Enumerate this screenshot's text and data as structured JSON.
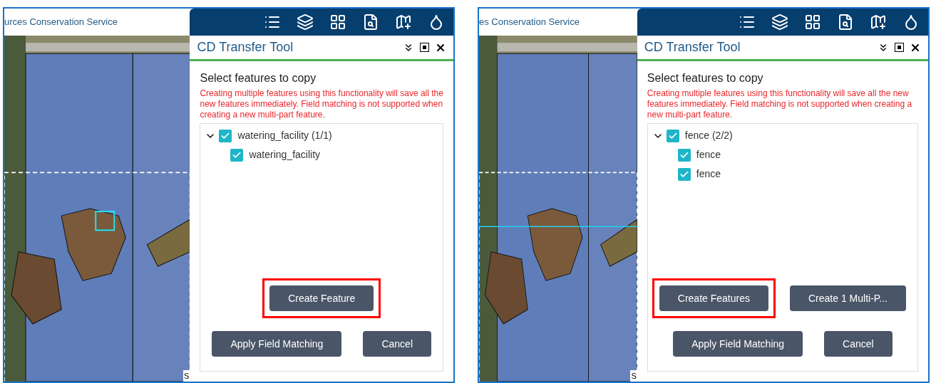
{
  "panels": [
    {
      "map": {
        "header": "urces Conservation Service",
        "corner_text": "S"
      },
      "tool": {
        "title": "CD Transfer Tool",
        "heading": "Select features to copy",
        "warning": "Creating multiple features using this functionality will save all the new features immediately. Field matching is not supported when creating a new multi-part feature.",
        "tree": [
          {
            "label": "watering_facility (1/1)",
            "checked": true,
            "expanded": true,
            "children": [
              {
                "label": "watering_facility",
                "checked": true
              }
            ]
          }
        ],
        "button_rows": [
          [
            {
              "label": "Create Feature",
              "highlighted": true
            }
          ],
          [
            {
              "label": "Apply Field Matching",
              "highlighted": false
            },
            {
              "label": "Cancel",
              "highlighted": false
            }
          ]
        ]
      }
    },
    {
      "map": {
        "header": "es Conservation Service",
        "corner_text": "S"
      },
      "tool": {
        "title": "CD Transfer Tool",
        "heading": "Select features to copy",
        "warning": "Creating multiple features using this functionality will save all the new features immediately. Field matching is not supported when creating a new multi-part feature.",
        "tree": [
          {
            "label": "fence (2/2)",
            "checked": true,
            "expanded": true,
            "children": [
              {
                "label": "fence",
                "checked": true
              },
              {
                "label": "fence",
                "checked": true
              }
            ]
          }
        ],
        "button_rows": [
          [
            {
              "label": "Create Features",
              "highlighted": true
            },
            {
              "label": "Create 1 Multi-P...",
              "highlighted": false
            }
          ],
          [
            {
              "label": "Apply Field Matching",
              "highlighted": false
            },
            {
              "label": "Cancel",
              "highlighted": false
            }
          ]
        ]
      }
    }
  ]
}
